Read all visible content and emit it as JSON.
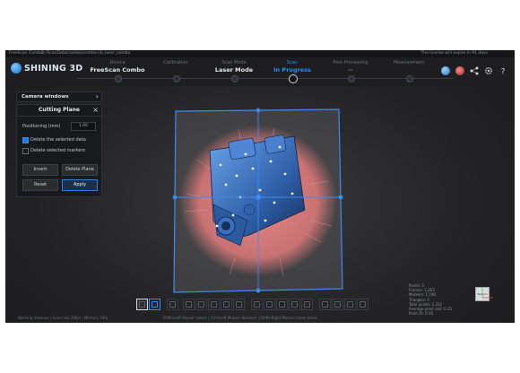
{
  "titlebar": {
    "app": "FreeScan Combo",
    "path": "D:/ScanData/combo/combo-cb_laser_combo",
    "license": "The license will expire in 91 days"
  },
  "brand": {
    "name": "SHINING 3D"
  },
  "steps": [
    {
      "category": "Device",
      "value": "FreeScan Combo",
      "state": "done"
    },
    {
      "category": "Calibration",
      "value": "",
      "state": "dim"
    },
    {
      "category": "Scan Mode",
      "value": "Laser Mode",
      "state": "done"
    },
    {
      "category": "Scan",
      "value": "In Progress",
      "state": "active"
    },
    {
      "category": "Post-Processing",
      "value": "--",
      "state": "dim"
    },
    {
      "category": "Measurement",
      "value": "",
      "state": "dim"
    }
  ],
  "top_icons": [
    "globe-icon",
    "share-icon",
    "link-icon",
    "gear-icon",
    "help-icon"
  ],
  "camera_windows": {
    "label": "Camera windows"
  },
  "cutting_plane": {
    "title": "Cutting Plane",
    "positioning_label": "Positioning (mm)",
    "positioning_value": "1.00",
    "delete_selected_data": {
      "label": "Delete the selected data",
      "checked": true
    },
    "delete_selected_markers": {
      "label": "Delete selected markers",
      "checked": false
    },
    "buttons": {
      "invert": "Invert",
      "delete_plane": "Delete Plane",
      "reset": "Reset",
      "apply": "Apply"
    }
  },
  "stats": [
    "Points: 1",
    "Frames: 1,263",
    "Markers: 1,748",
    "Triangles: 0",
    "Total points: 2,332",
    "Average point dist: 0.15",
    "Point ID: 0.16"
  ],
  "navcube_label": "Bottom",
  "status_left": "Working distance  |  Scan rate 20fps  |  Memory 18%",
  "status_center": "Shift+Left Mouse: select | Ctrl+Left Mouse: deselect | Shift+Right Mouse: move plane",
  "colors": {
    "accent": "#1f8fff",
    "plane_edge": "#3b8cf2",
    "point_cloud": "#e07c7c",
    "part_blue": "#3f78c8"
  }
}
